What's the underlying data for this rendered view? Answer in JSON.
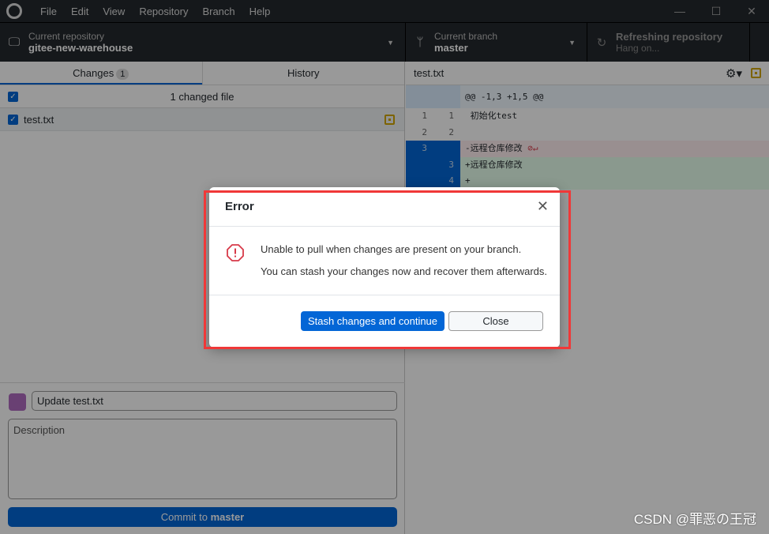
{
  "menu": [
    "File",
    "Edit",
    "View",
    "Repository",
    "Branch",
    "Help"
  ],
  "toolbar": {
    "repo_label": "Current repository",
    "repo_name": "gitee-new-warehouse",
    "branch_label": "Current branch",
    "branch_name": "master",
    "refresh_title": "Refreshing repository",
    "refresh_sub": "Hang on..."
  },
  "tabs": {
    "changes": "Changes",
    "changes_count": "1",
    "history": "History"
  },
  "changes": {
    "summary": "1 changed file",
    "files": [
      {
        "name": "test.txt",
        "status": "modified"
      }
    ]
  },
  "commit": {
    "summary_value": "Update test.txt",
    "description_placeholder": "Description",
    "button_prefix": "Commit to ",
    "button_branch": "master"
  },
  "diff": {
    "file": "test.txt",
    "hunk": "@@ -1,3 +1,5 @@",
    "lines": [
      {
        "old": "1",
        "new": "1",
        "text": " 初始化test",
        "type": "context"
      },
      {
        "old": "2",
        "new": "2",
        "text": "",
        "type": "context"
      },
      {
        "old": "3",
        "new": "",
        "text": "-远程仓库修改",
        "type": "del"
      },
      {
        "old": "",
        "new": "3",
        "text": "+远程仓库修改",
        "type": "add"
      },
      {
        "old": "",
        "new": "4",
        "text": "+",
        "type": "add"
      }
    ]
  },
  "dialog": {
    "title": "Error",
    "message1": "Unable to pull when changes are present on your branch.",
    "message2": "You can stash your changes now and recover them afterwards.",
    "primary": "Stash changes and continue",
    "secondary": "Close"
  },
  "watermark": "CSDN @罪恶の王冠",
  "colors": {
    "accent": "#0366d6",
    "highlight": "#f03838",
    "error": "#d73a49"
  }
}
